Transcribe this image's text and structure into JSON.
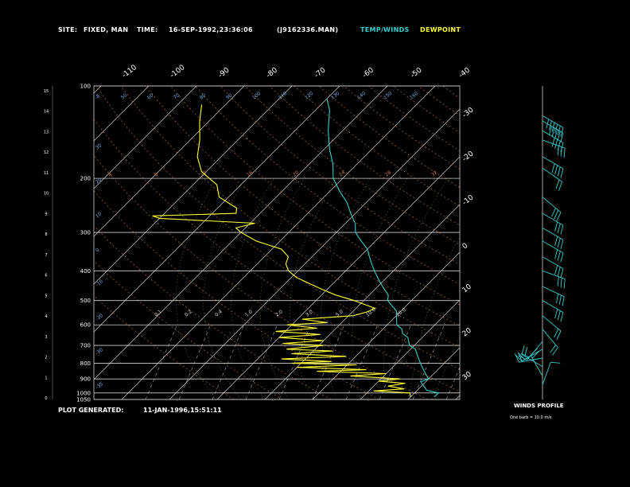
{
  "header": {
    "site_label": "SITE:",
    "site_value": "FIXED, MAN",
    "time_label": "TIME:",
    "time_value": "16-SEP-1992,23:36:06",
    "file_value": "(J9162336.MAN)",
    "temp_legend": "TEMP/WINDS",
    "dew_legend": "DEWPOINT",
    "temp_color": "#33cccc",
    "dew_color": "#ffff33"
  },
  "footer": {
    "plot_label": "PLOT GENERATED:",
    "plot_value": "11-JAN-1996,15:51:11",
    "winds_title": "WINDS PROFILE",
    "winds_note": "One barb = 10.0 m/s"
  },
  "chart_data": {
    "type": "line",
    "title": "",
    "pressure_ticks": [
      "100",
      "200",
      "300",
      "400",
      "500",
      "600",
      "700",
      "800",
      "900",
      "1000",
      "1050"
    ],
    "pressure_levels": [
      100,
      200,
      300,
      400,
      500,
      600,
      700,
      800,
      900,
      1000,
      1050
    ],
    "height_ticks": [
      "15",
      "14",
      "13",
      "12",
      "11",
      "10",
      "9",
      "8",
      "7",
      "6",
      "5",
      "4",
      "3",
      "2",
      "1",
      "0"
    ],
    "isotherm_ticks_top": [
      "-110",
      "-100",
      "-90",
      "-80",
      "-70",
      "-60",
      "-50",
      "-40"
    ],
    "isotherm_ticks_right": [
      "-30",
      "-20",
      "-10",
      "0",
      "10",
      "20",
      "30"
    ],
    "dry_adiabat_labels": [
      "-8",
      "50",
      "60",
      "70",
      "80",
      "90",
      "100",
      "110",
      "120",
      "130",
      "140",
      "150",
      "160"
    ],
    "mixing_ratio_upper": [
      "4",
      "8",
      "12",
      "16",
      "20",
      "24",
      "28",
      "32"
    ],
    "mixing_ratio_lower": [
      "0.1",
      "0.2",
      "0.4",
      "1.0",
      "2.0",
      "3.0",
      "5.0",
      "10.0",
      "20.0"
    ],
    "theta_left_labels": [
      "30",
      "20",
      "10",
      "0",
      "-10",
      "-20",
      "-30",
      "-35"
    ],
    "series": [
      {
        "name": "TEMP/WINDS",
        "color": "#33cccc",
        "points": [
          [
            1030,
            25
          ],
          [
            1000,
            25
          ],
          [
            980,
            22
          ],
          [
            960,
            21
          ],
          [
            940,
            20
          ],
          [
            920,
            19
          ],
          [
            900,
            20
          ],
          [
            880,
            19
          ],
          [
            860,
            18
          ],
          [
            840,
            17
          ],
          [
            820,
            16
          ],
          [
            800,
            15
          ],
          [
            780,
            14
          ],
          [
            760,
            13
          ],
          [
            740,
            12
          ],
          [
            720,
            11
          ],
          [
            700,
            9
          ],
          [
            680,
            8
          ],
          [
            660,
            7
          ],
          [
            640,
            5
          ],
          [
            620,
            4
          ],
          [
            600,
            2
          ],
          [
            580,
            1
          ],
          [
            560,
            0
          ],
          [
            540,
            -1
          ],
          [
            520,
            -3
          ],
          [
            500,
            -5
          ],
          [
            480,
            -6
          ],
          [
            460,
            -8
          ],
          [
            440,
            -10
          ],
          [
            420,
            -12
          ],
          [
            400,
            -14
          ],
          [
            380,
            -16
          ],
          [
            360,
            -18
          ],
          [
            340,
            -20
          ],
          [
            320,
            -23
          ],
          [
            300,
            -26
          ],
          [
            280,
            -28
          ],
          [
            260,
            -31
          ],
          [
            240,
            -34
          ],
          [
            220,
            -38
          ],
          [
            200,
            -42
          ],
          [
            180,
            -45
          ],
          [
            160,
            -49
          ],
          [
            140,
            -53
          ],
          [
            120,
            -57
          ],
          [
            110,
            -60
          ]
        ]
      },
      {
        "name": "DEWPOINT",
        "color": "#ffff33",
        "points": [
          [
            1030,
            20
          ],
          [
            1000,
            19
          ],
          [
            985,
            11
          ],
          [
            970,
            17
          ],
          [
            950,
            13
          ],
          [
            930,
            16
          ],
          [
            915,
            10
          ],
          [
            900,
            14
          ],
          [
            880,
            3
          ],
          [
            865,
            10
          ],
          [
            850,
            -5
          ],
          [
            840,
            5
          ],
          [
            825,
            -10
          ],
          [
            810,
            2
          ],
          [
            800,
            -12
          ],
          [
            790,
            -4
          ],
          [
            775,
            -15
          ],
          [
            760,
            -2
          ],
          [
            745,
            -14
          ],
          [
            730,
            -6
          ],
          [
            720,
            -16
          ],
          [
            700,
            -9
          ],
          [
            690,
            -18
          ],
          [
            675,
            -10
          ],
          [
            660,
            -20
          ],
          [
            645,
            -12
          ],
          [
            630,
            -22
          ],
          [
            615,
            -14
          ],
          [
            600,
            -21
          ],
          [
            590,
            -13
          ],
          [
            575,
            -19
          ],
          [
            560,
            -9
          ],
          [
            545,
            -7
          ],
          [
            530,
            -6
          ],
          [
            515,
            -9
          ],
          [
            500,
            -12
          ],
          [
            480,
            -17
          ],
          [
            460,
            -21
          ],
          [
            440,
            -25
          ],
          [
            420,
            -29
          ],
          [
            400,
            -32
          ],
          [
            380,
            -34
          ],
          [
            360,
            -35
          ],
          [
            340,
            -38
          ],
          [
            320,
            -45
          ],
          [
            300,
            -50
          ],
          [
            290,
            -52
          ],
          [
            280,
            -49
          ],
          [
            270,
            -70
          ],
          [
            265,
            -72
          ],
          [
            260,
            -55
          ],
          [
            250,
            -56
          ],
          [
            230,
            -62
          ],
          [
            210,
            -65
          ],
          [
            190,
            -71
          ],
          [
            170,
            -75
          ],
          [
            150,
            -78
          ],
          [
            130,
            -82
          ],
          [
            115,
            -85
          ]
        ]
      }
    ],
    "wind_barbs": [
      {
        "p": 125,
        "dir": 300,
        "spd": 60
      },
      {
        "p": 130,
        "dir": 300,
        "spd": 45
      },
      {
        "p": 140,
        "dir": 300,
        "spd": 40
      },
      {
        "p": 150,
        "dir": 290,
        "spd": 30
      },
      {
        "p": 170,
        "dir": 300,
        "spd": 35
      },
      {
        "p": 185,
        "dir": 305,
        "spd": 20
      },
      {
        "p": 230,
        "dir": 310,
        "spd": 25
      },
      {
        "p": 260,
        "dir": 300,
        "spd": 30
      },
      {
        "p": 290,
        "dir": 300,
        "spd": 30
      },
      {
        "p": 320,
        "dir": 300,
        "spd": 25
      },
      {
        "p": 360,
        "dir": 300,
        "spd": 25
      },
      {
        "p": 400,
        "dir": 290,
        "spd": 25
      },
      {
        "p": 450,
        "dir": 295,
        "spd": 25
      },
      {
        "p": 500,
        "dir": 300,
        "spd": 25
      },
      {
        "p": 560,
        "dir": 310,
        "spd": 20
      },
      {
        "p": 620,
        "dir": 320,
        "spd": 15
      },
      {
        "p": 680,
        "dir": 40,
        "spd": 20
      },
      {
        "p": 720,
        "dir": 60,
        "spd": 15
      },
      {
        "p": 770,
        "dir": 80,
        "spd": 15
      },
      {
        "p": 820,
        "dir": 120,
        "spd": 15
      },
      {
        "p": 880,
        "dir": 150,
        "spd": 20
      },
      {
        "p": 940,
        "dir": 200,
        "spd": 10
      }
    ]
  }
}
